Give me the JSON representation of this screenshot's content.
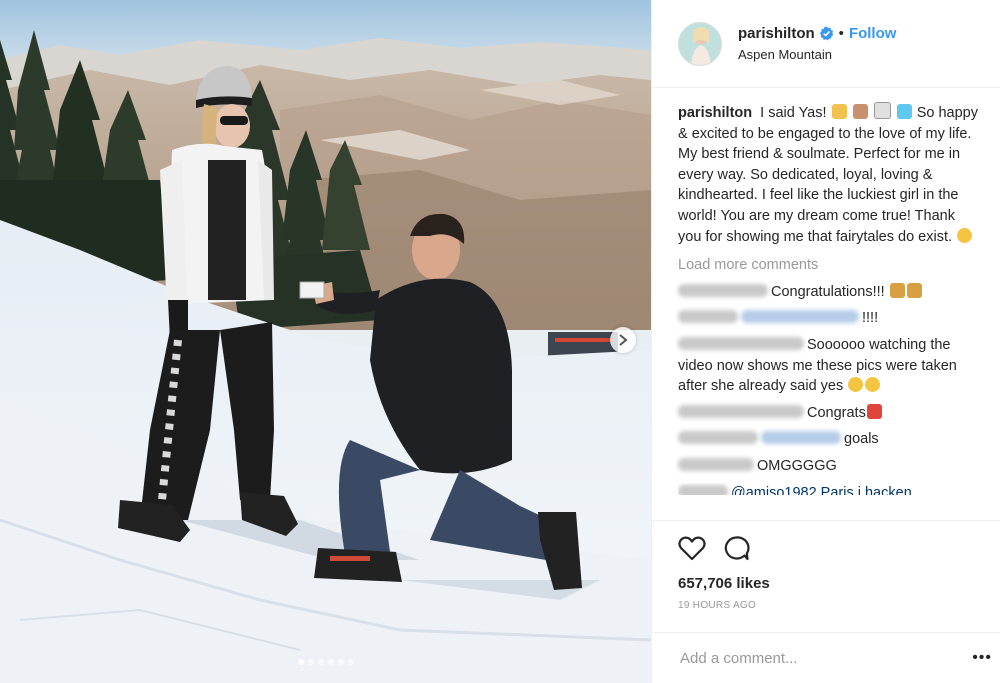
{
  "header": {
    "username": "parishilton",
    "separator": "•",
    "follow_label": "Follow",
    "location": "Aspen Mountain",
    "verified_icon": "verified-badge-icon"
  },
  "caption": {
    "username": "parishilton",
    "text_lead": "I said Yas!",
    "text_main": "So happy & excited to be engaged to the love of my life. My best friend & soulmate. Perfect for me in every way. So dedicated, loyal, loving & kindhearted. I feel like the luckiest girl in the world! You are my dream come true! Thank you for showing me that fairytales do exist."
  },
  "load_more_label": "Load more comments",
  "comments": [
    {
      "text": "Congratulations!!!"
    },
    {
      "text": "!!!!"
    },
    {
      "text": "Soooooo watching the video now shows me these pics were taken after she already said yes"
    },
    {
      "text": "Congrats"
    },
    {
      "text": "goals"
    },
    {
      "text": "OMGGGGG"
    },
    {
      "text": "@amiso1982 Paris i hacken"
    }
  ],
  "actions": {
    "like_icon": "heart-icon",
    "comment_icon": "comment-icon",
    "likes": "657,706 likes",
    "timestamp": "19 HOURS AGO"
  },
  "add_comment": {
    "placeholder": "Add a comment...",
    "more_label": "•••"
  },
  "carousel": {
    "total_slides": 6,
    "active_index": 0
  },
  "colors": {
    "follow": "#3897f0",
    "verified": "#3897f0",
    "muted": "#999999",
    "text": "#262626"
  }
}
